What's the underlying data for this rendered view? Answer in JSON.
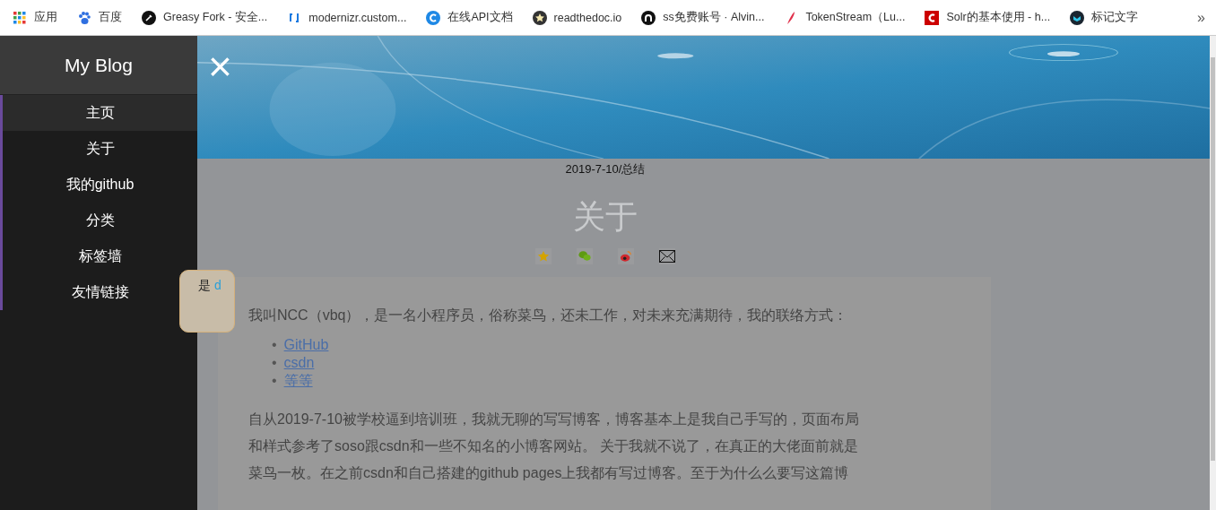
{
  "bookmarks": [
    {
      "label": "应用"
    },
    {
      "label": "百度"
    },
    {
      "label": "Greasy Fork - 安全..."
    },
    {
      "label": "modernizr.custom..."
    },
    {
      "label": "在线API文档"
    },
    {
      "label": "readthedoc.io"
    },
    {
      "label": "ss免费账号 · Alvin..."
    },
    {
      "label": "TokenStream（Lu..."
    },
    {
      "label": "Solr的基本使用 - h..."
    },
    {
      "label": "标记文字"
    }
  ],
  "more": "»",
  "sidebar": {
    "title": "My Blog",
    "items": [
      {
        "label": "主页",
        "selected": true
      },
      {
        "label": "关于",
        "selected": false
      },
      {
        "label": "我的github",
        "selected": false
      },
      {
        "label": "分类",
        "selected": false
      },
      {
        "label": "标签墙",
        "selected": false
      },
      {
        "label": "友情链接",
        "selected": false
      }
    ]
  },
  "close": "×",
  "post": {
    "date": "2019-7-10/总结",
    "title": "关于",
    "share_icons": [
      {
        "kind": "qzone"
      },
      {
        "kind": "wechat"
      },
      {
        "kind": "weibo"
      },
      {
        "kind": "mail"
      }
    ],
    "bubble": {
      "text": "是 ",
      "link": "d"
    },
    "intro": "我叫NCC（vbq），是一名小程序员，俗称菜鸟，还未工作，对未来充满期待，我的联络方式：",
    "links": [
      {
        "bullet": "•",
        "label": "GitHub"
      },
      {
        "bullet": "•",
        "label": "csdn"
      },
      {
        "bullet": "•",
        "label": "等等"
      }
    ],
    "paragraph": "自从2019-7-10被学校逼到培训班，我就无聊的写写博客，博客基本上是我自己手写的，页面布局和样式参考了soso跟csdn和一些不知名的小博客网站。 关于我就不说了，在真正的大佬面前就是菜鸟一枚。在之前csdn和自己搭建的github pages上我都有写过博客。至于为什么么要写这篇博"
  }
}
